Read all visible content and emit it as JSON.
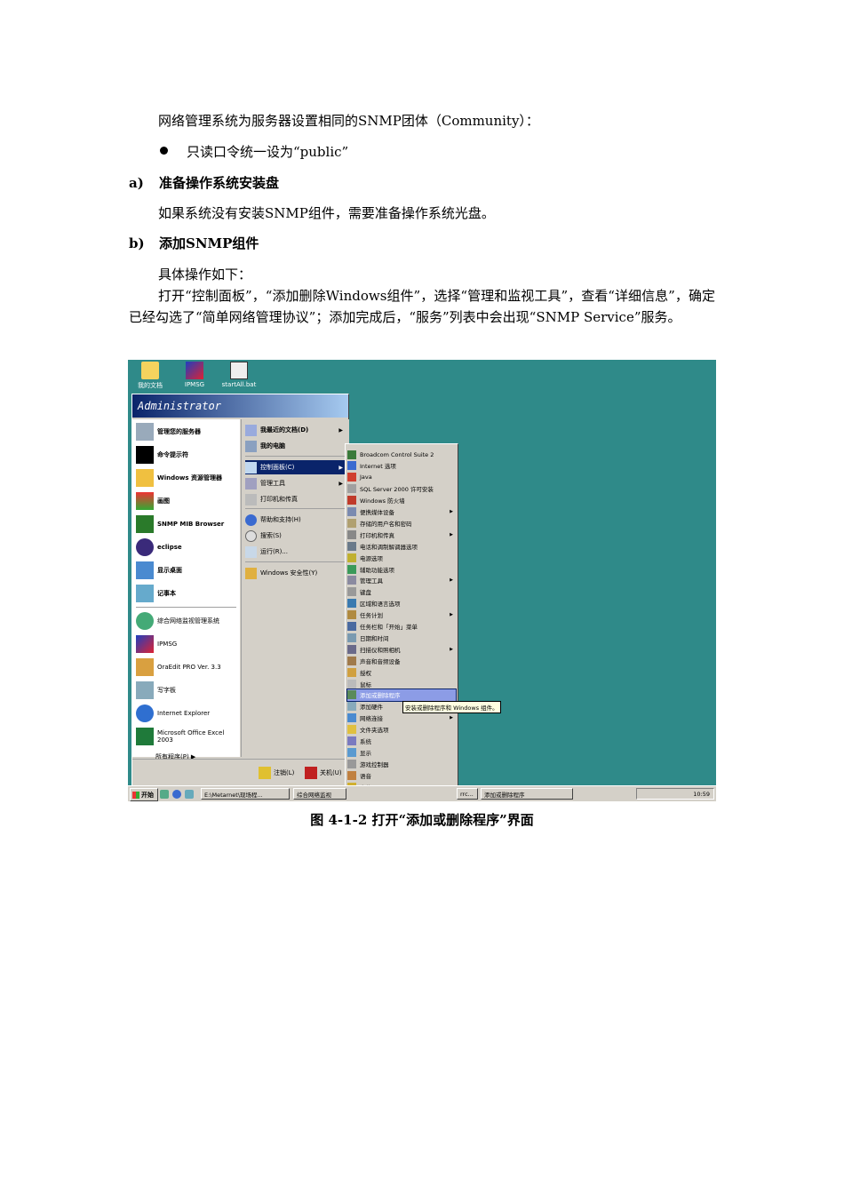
{
  "doc": {
    "para1": "网络管理系统为服务器设置相同的SNMP团体（Community）：",
    "bullet1": "只读口令统一设为“public”",
    "heading_a": {
      "num": "a)",
      "text": "准备操作系统安装盘"
    },
    "para2": "如果系统没有安装SNMP组件，需要准备操作系统光盘。",
    "heading_b": {
      "num": "b)",
      "text": "添加SNMP组件"
    },
    "para3": "具体操作如下：",
    "para4": "打开“控制面板”，“添加删除Windows组件”，选择“管理和监视工具”，查看“详细信息”，确定已经勾选了“简单网络管理协议”；添加完成后，“服务”列表中会出现“SNMP Service”服务。",
    "caption": "图 4-1-2  打开“添加或删除程序”界面"
  },
  "screenshot": {
    "desktop_icons": [
      "我的文档",
      "IPMSG",
      "startAll.bat"
    ],
    "user": "Administrator",
    "left_items": [
      "管理您的服务器",
      "命令提示符",
      "Windows 资源管理器",
      "画图",
      "SNMP MIB Browser",
      "eclipse",
      "显示桌面",
      "记事本",
      "综合网络监视管理系统",
      "IPMSG",
      "OraEdit PRO Ver. 3.3",
      "写字板",
      "Internet Explorer",
      "Microsoft Office Excel 2003"
    ],
    "all_programs": "所有程序(P)",
    "right_items": [
      "我最近的文档(D)",
      "我的电脑",
      "控制面板(C)",
      "管理工具",
      "打印机和传真",
      "帮助和支持(H)",
      "搜索(S)",
      "运行(R)...",
      "Windows 安全性(Y)"
    ],
    "logoff": "注销(L)",
    "shutdown": "关机(U)",
    "control_panel_items": [
      "Broadcom Control Suite 2",
      "Internet 选项",
      "Java",
      "SQL Server 2000 许可安装",
      "Windows 防火墙",
      "便携媒体设备",
      "存储的用户名和密码",
      "打印机和传真",
      "电话和调制解调器选项",
      "电源选项",
      "辅助功能选项",
      "管理工具",
      "键盘",
      "区域和语言选项",
      "任务计划",
      "任务栏和「开始」菜单",
      "日期和时间",
      "扫描仪和照相机",
      "声音和音频设备",
      "授权",
      "鼠标",
      "添加或删除程序",
      "添加硬件",
      "网络连接",
      "文件夹选项",
      "系统",
      "显示",
      "游戏控制器",
      "语音",
      "字体",
      "自动更新"
    ],
    "tooltip": "安装或删除程序和 Windows 组件。",
    "taskbar": {
      "start": "开始",
      "buttons": [
        "E:\\Metarnet\\现场程...",
        "综合网络监视",
        "rrc...",
        "添加或删除程序"
      ],
      "clock": "10:59"
    },
    "colors": {
      "desktop": "#2f8a89",
      "highlight": "#0a246a"
    }
  }
}
